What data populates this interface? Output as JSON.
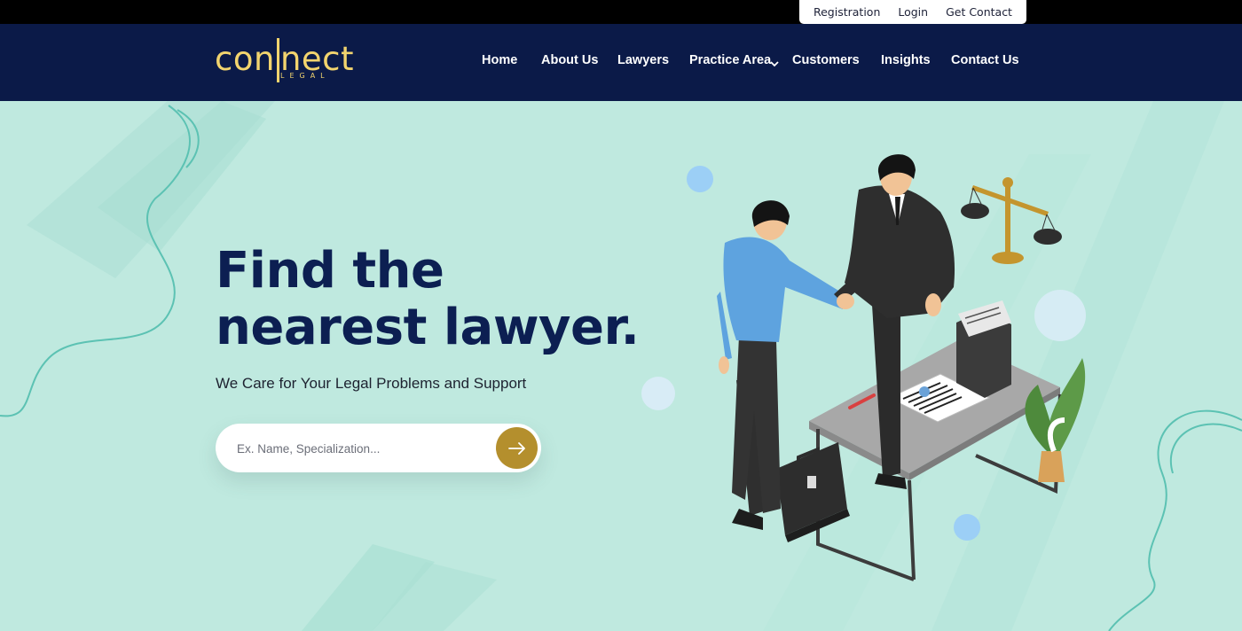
{
  "util_bar": {
    "links": [
      "Registration",
      "Login",
      "Get Contact"
    ]
  },
  "brand": {
    "logo_text": "con|nect",
    "logo_sub": "LEGAL",
    "accent": "#f2d46e"
  },
  "nav": {
    "items": [
      "Home",
      "About Us",
      "Lawyers",
      "Practice Area",
      "Customers",
      "Insights",
      "Contact Us"
    ],
    "dropdown_icon": "chevron-down-icon"
  },
  "hero": {
    "title_line1": "Find the",
    "title_line2": "nearest lawyer.",
    "subtitle": "We Care for Your Legal Problems and Support",
    "search_placeholder": "Ex. Name, Specialization...",
    "search_button_icon": "arrow-right-icon",
    "illustration": "lawyer-handshake-illustration"
  },
  "colors": {
    "header_bg": "#0b1a48",
    "hero_bg": "#bfe9df",
    "title": "#0c1f52",
    "button": "#b48f2d"
  }
}
